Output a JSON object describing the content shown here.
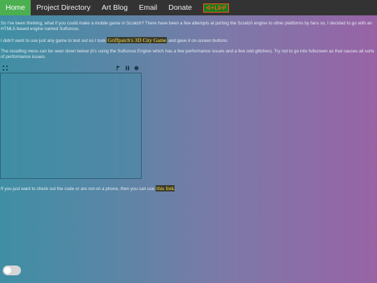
{
  "nav": {
    "items": [
      {
        "label": "Home"
      },
      {
        "label": "Project Directory"
      },
      {
        "label": "Art Blog"
      },
      {
        "label": "Email"
      },
      {
        "label": "Donate"
      }
    ],
    "badge": "ᐊ•ᒪᐅᑭ"
  },
  "article": {
    "p1": "So I've been thinking, what if you could make a mobile game in Scratch? There have been a few attempts at porting the Scratch engine to other platforms by fans so, I decided to go with an HTML5 based engine named Sulfurous.",
    "p2_before": "I didn't want to use just any game to test out so I took ",
    "p2_link": "Griffpatch's 3D City Game",
    "p2_after": " and gave it on-screen buttons.",
    "p3": "The resulting mess can be seen down below (it's using the Sulfurous Engine which has a few performance issues and a few odd glitches). Try not to go into fullscreen as that causes all sorts of performance issues.",
    "p4_before": "If you just want to check out the code or are not on a phone, then you can use ",
    "p4_link": "this link",
    "p4_after": "."
  },
  "player": {
    "icons": [
      "fullscreen-icon",
      "flag-icon",
      "pause-icon",
      "stop-icon"
    ]
  },
  "toggle": {
    "state": "off"
  },
  "colors": {
    "nav_bg": "#333333",
    "nav_active": "#4caf50",
    "link_text": "#ffe74a",
    "gradient_left": "#3f8fa4",
    "gradient_right": "#9863a6"
  }
}
